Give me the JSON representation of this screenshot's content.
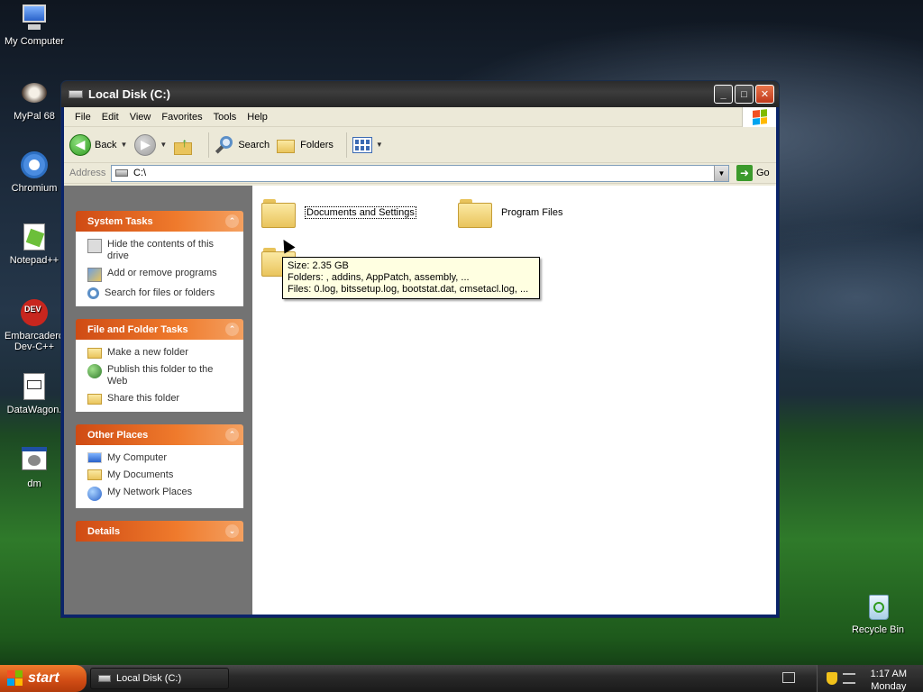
{
  "desktop": {
    "icons": [
      {
        "label": "My Computer"
      },
      {
        "label": "MyPal 68"
      },
      {
        "label": "Chromium"
      },
      {
        "label": "Notepad++"
      },
      {
        "label": "Embarcadero Dev-C++"
      },
      {
        "label": "DataWagon."
      },
      {
        "label": "dm"
      },
      {
        "label": "Recycle Bin"
      }
    ]
  },
  "window": {
    "title": "Local Disk (C:)",
    "buttons": {
      "minimize": "_",
      "maximize": "□",
      "close": "✕"
    }
  },
  "menu": [
    "File",
    "Edit",
    "View",
    "Favorites",
    "Tools",
    "Help"
  ],
  "toolbar": {
    "back": "Back",
    "search": "Search",
    "folders": "Folders"
  },
  "address": {
    "label": "Address",
    "value": "C:\\",
    "go": "Go"
  },
  "tasks": {
    "system": {
      "title": "System Tasks",
      "items": [
        "Hide the contents of this drive",
        "Add or remove programs",
        "Search for files or folders"
      ]
    },
    "file_folder": {
      "title": "File and Folder Tasks",
      "items": [
        "Make a new folder",
        "Publish this folder to the Web",
        "Share this folder"
      ]
    },
    "other": {
      "title": "Other Places",
      "items": [
        "My Computer",
        "My Documents",
        "My Network Places"
      ]
    },
    "details": {
      "title": "Details"
    }
  },
  "files": {
    "items": [
      "Documents and Settings",
      "Program Files"
    ]
  },
  "tooltip": {
    "size": "Size: 2.35 GB",
    "folders": "Folders: , addins, AppPatch, assembly, ...",
    "files": "Files: 0.log, bitssetup.log, bootstat.dat, cmsetacl.log, ..."
  },
  "taskbar": {
    "start": "start",
    "task": "Local Disk (C:)",
    "time": "1:17 AM",
    "day": "Monday"
  },
  "colors": {
    "task_header": "#ef7a2c",
    "task_pane": "#737373",
    "taskbar": "#2a2a2a"
  }
}
